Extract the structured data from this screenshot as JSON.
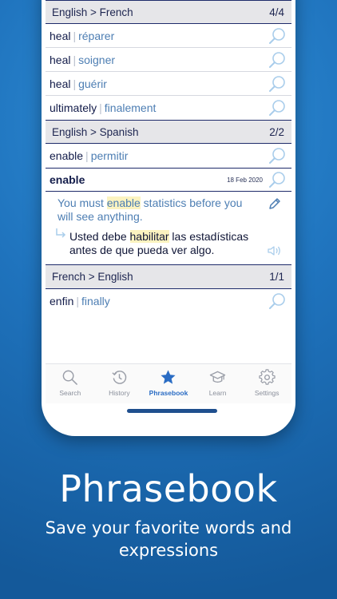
{
  "sections": [
    {
      "title": "English > French",
      "count": "4/4",
      "entries": [
        {
          "source": "heal",
          "target": "réparer"
        },
        {
          "source": "heal",
          "target": "soigner"
        },
        {
          "source": "heal",
          "target": "guérir"
        },
        {
          "source": "ultimately",
          "target": "finalement"
        }
      ]
    },
    {
      "title": "English > Spanish",
      "count": "2/2",
      "entries": [
        {
          "source": "enable",
          "target": "permitir"
        }
      ],
      "expanded": {
        "word": "enable",
        "date": "18 Feb 2020",
        "example_en": {
          "before": "You must ",
          "highlight": "enable",
          "after": " statistics before you will see anything."
        },
        "example_es": {
          "before": "Usted debe ",
          "highlight": "habilitar",
          "after": " las estadísticas antes de que pueda ver algo."
        }
      }
    },
    {
      "title": "French > English",
      "count": "1/1",
      "entries": [
        {
          "source": "enfin",
          "target": "finally"
        }
      ]
    }
  ],
  "separator": "|",
  "tabs": [
    {
      "label": "Search",
      "icon": "search-icon",
      "active": false
    },
    {
      "label": "History",
      "icon": "history-icon",
      "active": false
    },
    {
      "label": "Phrasebook",
      "icon": "star-icon",
      "active": true
    },
    {
      "label": "Learn",
      "icon": "graduation-cap-icon",
      "active": false
    },
    {
      "label": "Settings",
      "icon": "gear-icon",
      "active": false
    }
  ],
  "colors": {
    "accent": "#2a6cc4",
    "source_text": "#131c4a",
    "target_text": "#4d7eb3",
    "highlight": "#fbf3c0",
    "background": "#1f73bd"
  },
  "promo": {
    "headline": "Phrasebook",
    "subline": "Save your favorite words and expressions"
  }
}
